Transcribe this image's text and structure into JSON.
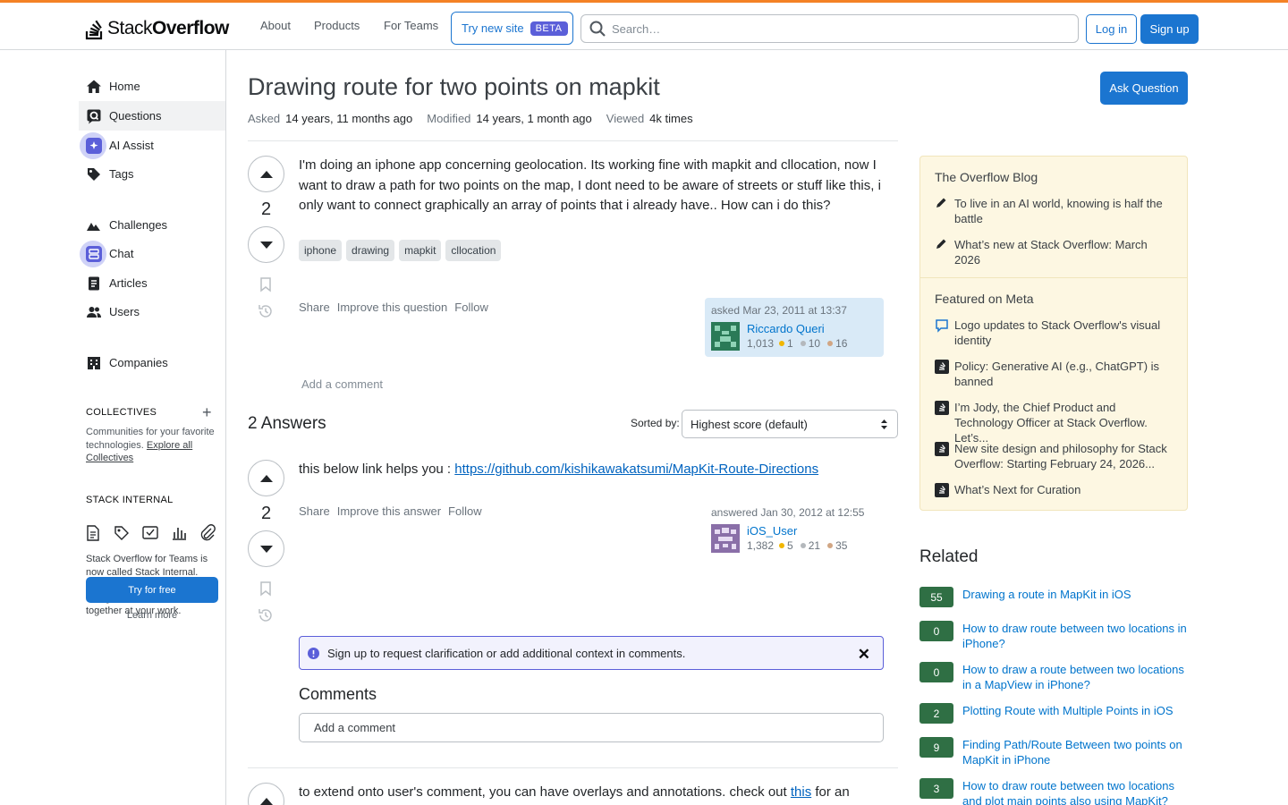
{
  "header": {
    "logo_text_light": "Stack",
    "logo_text_bold": "Overflow",
    "nav": [
      "About",
      "Products",
      "For Teams"
    ],
    "try_new_label": "Try new site",
    "beta_badge": "BETA",
    "search_placeholder": "Search…",
    "login_label": "Log in",
    "signup_label": "Sign up",
    "accent_color": "#f48225"
  },
  "sidebar": {
    "items": [
      {
        "label": "Home",
        "icon": "home-icon"
      },
      {
        "label": "Questions",
        "icon": "questions-icon",
        "active": true
      },
      {
        "label": "AI Assist",
        "icon": "ai-assist-icon"
      },
      {
        "label": "Tags",
        "icon": "tag-icon"
      },
      {
        "label": "Challenges",
        "icon": "challenges-icon"
      },
      {
        "label": "Chat",
        "icon": "chat-icon"
      },
      {
        "label": "Articles",
        "icon": "articles-icon"
      },
      {
        "label": "Users",
        "icon": "users-icon"
      },
      {
        "label": "Companies",
        "icon": "companies-icon"
      }
    ],
    "collectives_title": "COLLECTIVES",
    "collectives_text": "Communities for your favorite technologies.",
    "collectives_link": "Explore all Collectives",
    "internal_title": "STACK INTERNAL",
    "internal_text": "Stack Overflow for Teams is now called Stack Internal. Bring the best of human thought and AI automation together at your work.",
    "try_free_label": "Try for free",
    "learn_more_label": "Learn more"
  },
  "question": {
    "title": "Drawing route for two points on mapkit",
    "asked_label": "Asked",
    "asked_value": "14 years, 11 months ago",
    "modified_label": "Modified",
    "modified_value": "14 years, 1 month ago",
    "viewed_label": "Viewed",
    "viewed_value": "4k times",
    "ask_button": "Ask Question",
    "score": "2",
    "body": "I'm doing an iphone app concerning geolocation. Its working fine with mapkit and cllocation, now I want to draw a path for two points on the map, I dont need to be aware of streets or stuff like this, i only want to connect graphically an array of points that i already have.. How can i do this?",
    "tags": [
      "iphone",
      "drawing",
      "mapkit",
      "cllocation"
    ],
    "actions": [
      "Share",
      "Improve this question",
      "Follow"
    ],
    "asked_time": "asked Mar 23, 2011 at 13:37",
    "author": "Riccardo Queri",
    "rep": "1,013",
    "gold": "1",
    "silver": "10",
    "bronze": "16",
    "add_comment": "Add a comment"
  },
  "answers": {
    "heading": "2 Answers",
    "sorted_label": "Sorted by:",
    "sort_value": "Highest score (default)",
    "first": {
      "score": "2",
      "text": "this below link helps you : ",
      "link": "https://github.com/kishikawakatsumi/MapKit-Route-Directions",
      "actions": [
        "Share",
        "Improve this answer",
        "Follow"
      ],
      "answered_time": "answered Jan 30, 2012 at 12:55",
      "author": "iOS_User",
      "rep": "1,382",
      "gold": "5",
      "silver": "21",
      "bronze": "35"
    },
    "notice": "Sign up to request clarification or add additional context in comments.",
    "comments_heading": "Comments",
    "comment_placeholder": "Add a comment",
    "second": {
      "text_before": "to extend onto user's comment, you can have overlays and annotations. check out ",
      "link": "this",
      "text_after": " for an"
    }
  },
  "blog": {
    "heading": "The Overflow Blog",
    "items": [
      "To live in an AI world, knowing is half the battle",
      "What’s new at Stack Overflow: March 2026"
    ],
    "meta_heading": "Featured on Meta",
    "meta_items": [
      "Logo updates to Stack Overflow's visual identity",
      "Policy: Generative AI (e.g., ChatGPT) is banned",
      "I’m Jody, the Chief Product and Technology Officer at Stack Overflow. Let’s...",
      "New site design and philosophy for Stack Overflow: Starting February 24, 2026...",
      "What’s Next for Curation"
    ]
  },
  "related": {
    "heading": "Related",
    "items": [
      {
        "score": "55",
        "title": "Drawing a route in MapKit in iOS"
      },
      {
        "score": "0",
        "title": "How to draw route between two locations in iPhone?"
      },
      {
        "score": "0",
        "title": "How to draw a route between two locations in a MapView in iPhone?"
      },
      {
        "score": "2",
        "title": "Plotting Route with Multiple Points in iOS"
      },
      {
        "score": "9",
        "title": "Finding Path/Route Between two points on MapKit in iPhone"
      },
      {
        "score": "3",
        "title": "How to draw route between two locations and plot main points also using MapKit?"
      }
    ]
  }
}
